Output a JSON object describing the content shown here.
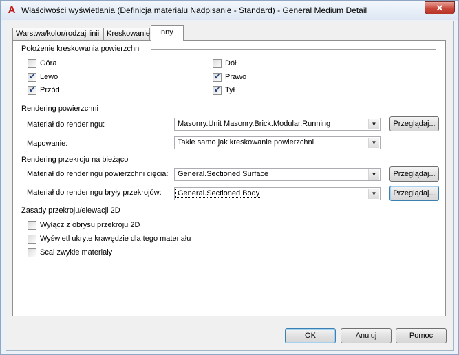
{
  "window": {
    "title": "Właściwości wyświetlania (Definicja materiału Nadpisanie - Standard) - General Medium Detail",
    "app_icon": "A",
    "close_glyph": "✕"
  },
  "tabs": [
    {
      "label": "Warstwa/kolor/rodzaj linii",
      "active": false
    },
    {
      "label": "Kreskowanie",
      "active": false
    },
    {
      "label": "Inny",
      "active": true
    }
  ],
  "surface_hatch_placement": {
    "title": "Położenie kreskowania powierzchni",
    "checkboxes": [
      {
        "label": "Góra",
        "checked": false
      },
      {
        "label": "Dół",
        "checked": false
      },
      {
        "label": "Lewo",
        "checked": true
      },
      {
        "label": "Prawo",
        "checked": true
      },
      {
        "label": "Przód",
        "checked": true
      },
      {
        "label": "Tył",
        "checked": true
      }
    ]
  },
  "surface_rendering": {
    "title": "Rendering powierzchni",
    "material_label": "Materiał do renderingu:",
    "material_value": "Masonry.Unit Masonry.Brick.Modular.Running",
    "mapping_label": "Mapowanie:",
    "mapping_value": "Takie samo jak kreskowanie powierzchni",
    "browse_label": "Przeglądaj..."
  },
  "live_section_rendering": {
    "title": "Rendering przekroju na bieżąco",
    "cut_surface_label": "Materiał do renderingu powierzchni cięcia:",
    "cut_surface_value": "General.Sectioned Surface",
    "sectioned_body_label": "Materiał do renderingu bryły przekrojów:",
    "sectioned_body_value": "General.Sectioned Body",
    "browse_label": "Przeglądaj..."
  },
  "section_rules": {
    "title": "Zasady przekroju/elewacji 2D",
    "checkboxes": [
      {
        "label": "Wyłącz z obrysu przekroju 2D",
        "checked": false
      },
      {
        "label": "Wyświetl ukryte krawędzie dla tego materiału",
        "checked": false
      },
      {
        "label": "Scal zwykłe materiały",
        "checked": false
      }
    ]
  },
  "footer": {
    "ok_label": "OK",
    "cancel_label": "Anuluj",
    "help_label": "Pomoc"
  },
  "check_glyph": "✓",
  "dropdown_glyph": "▼",
  "colors": {
    "accent_focus": "#3c7fb1",
    "close_red": "#c9463a",
    "app_icon_red": "#c31b1b"
  }
}
